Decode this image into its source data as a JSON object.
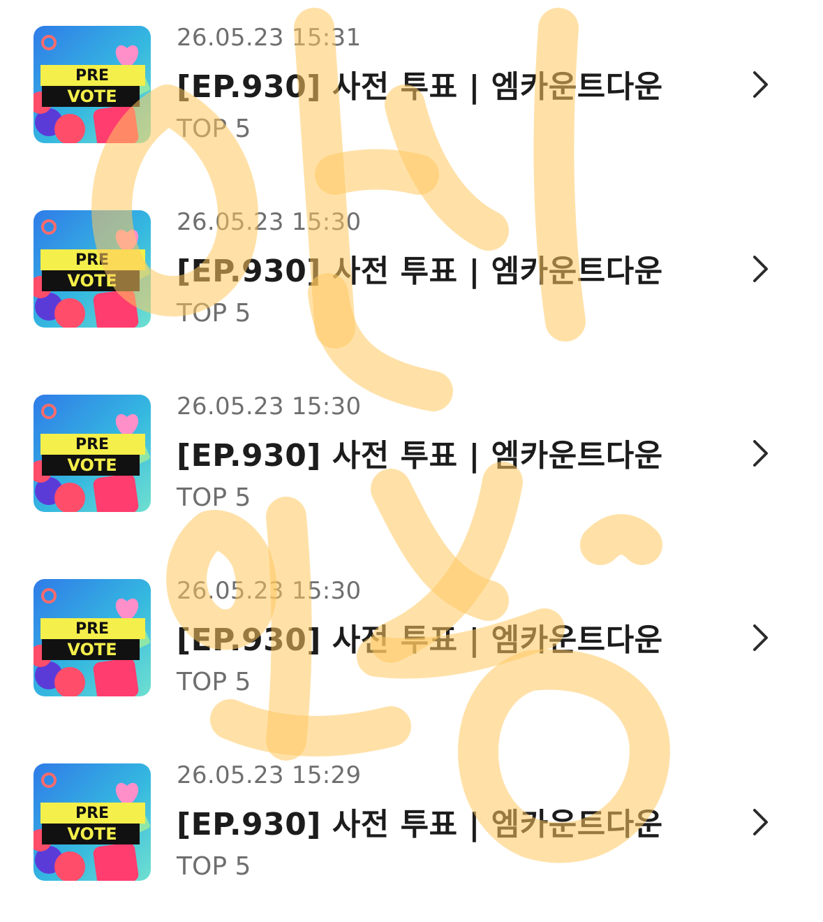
{
  "items": [
    {
      "time": "26.05.23 15:31",
      "title": "[EP.930] 사전 투표 | 엠카운트다운",
      "subtitle": "TOP 5",
      "thumb_top": "PRE",
      "thumb_bottom": "VOTE"
    },
    {
      "time": "26.05.23 15:30",
      "title": "[EP.930] 사전 투표 | 엠카운트다운",
      "subtitle": "TOP 5",
      "thumb_top": "PRE",
      "thumb_bottom": "VOTE"
    },
    {
      "time": "26.05.23 15:30",
      "title": "[EP.930] 사전 투표 | 엠카운트다운",
      "subtitle": "TOP 5",
      "thumb_top": "PRE",
      "thumb_bottom": "VOTE"
    },
    {
      "time": "26.05.23 15:30",
      "title": "[EP.930] 사전 투표 | 엠카운트다운",
      "subtitle": "TOP 5",
      "thumb_top": "PRE",
      "thumb_bottom": "VOTE"
    },
    {
      "time": "26.05.23 15:29",
      "title": "[EP.930] 사전 투표 | 엠카운트다운",
      "subtitle": "TOP 5",
      "thumb_top": "PRE",
      "thumb_bottom": "VOTE"
    }
  ],
  "icons": {
    "row_action": "chevron-right-icon",
    "thumbnail": "pre-vote-thumbnail"
  },
  "colors": {
    "title": "#1c1c1c",
    "secondary_text": "#6e6e6e",
    "watermark": "#ffc861",
    "thumb_banner_yellow": "#f4ef4a",
    "thumb_banner_black": "#111111",
    "thumb_bg_blue": "#2f7be8"
  }
}
